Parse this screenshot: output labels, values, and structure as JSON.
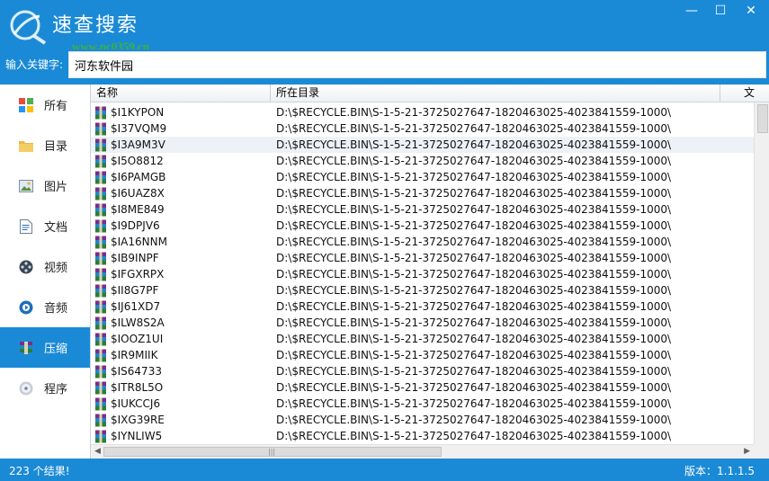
{
  "window": {
    "title": "速查搜索",
    "watermark": "www.pc0359.cn",
    "buttons": {
      "minimize": "—",
      "maximize": "☐",
      "close": "✕"
    }
  },
  "search": {
    "label": "输入关键字:",
    "value": "河东软件园"
  },
  "sidebar": {
    "items": [
      {
        "label": "所有",
        "icon": "all-icon"
      },
      {
        "label": "目录",
        "icon": "folder-icon"
      },
      {
        "label": "图片",
        "icon": "picture-icon"
      },
      {
        "label": "文档",
        "icon": "document-icon"
      },
      {
        "label": "视频",
        "icon": "video-icon"
      },
      {
        "label": "音频",
        "icon": "audio-icon"
      },
      {
        "label": "压缩",
        "icon": "archive-icon",
        "active": true
      },
      {
        "label": "程序",
        "icon": "program-icon"
      }
    ]
  },
  "table": {
    "columns": [
      "名称",
      "所在目录",
      "文"
    ],
    "rows": [
      {
        "name": "$I1KYPON",
        "dir": "D:\\$RECYCLE.BIN\\S-1-5-21-3725027647-1820463025-4023841559-1000\\"
      },
      {
        "name": "$I37VQM9",
        "dir": "D:\\$RECYCLE.BIN\\S-1-5-21-3725027647-1820463025-4023841559-1000\\"
      },
      {
        "name": "$I3A9M3V",
        "dir": "D:\\$RECYCLE.BIN\\S-1-5-21-3725027647-1820463025-4023841559-1000\\",
        "selected": true
      },
      {
        "name": "$I5O8812",
        "dir": "D:\\$RECYCLE.BIN\\S-1-5-21-3725027647-1820463025-4023841559-1000\\"
      },
      {
        "name": "$I6PAMGB",
        "dir": "D:\\$RECYCLE.BIN\\S-1-5-21-3725027647-1820463025-4023841559-1000\\"
      },
      {
        "name": "$I6UAZ8X",
        "dir": "D:\\$RECYCLE.BIN\\S-1-5-21-3725027647-1820463025-4023841559-1000\\"
      },
      {
        "name": "$I8ME849",
        "dir": "D:\\$RECYCLE.BIN\\S-1-5-21-3725027647-1820463025-4023841559-1000\\"
      },
      {
        "name": "$I9DPJV6",
        "dir": "D:\\$RECYCLE.BIN\\S-1-5-21-3725027647-1820463025-4023841559-1000\\"
      },
      {
        "name": "$IA16NNM",
        "dir": "D:\\$RECYCLE.BIN\\S-1-5-21-3725027647-1820463025-4023841559-1000\\"
      },
      {
        "name": "$IB9INPF",
        "dir": "D:\\$RECYCLE.BIN\\S-1-5-21-3725027647-1820463025-4023841559-1000\\"
      },
      {
        "name": "$IFGXRPX",
        "dir": "D:\\$RECYCLE.BIN\\S-1-5-21-3725027647-1820463025-4023841559-1000\\"
      },
      {
        "name": "$II8G7PF",
        "dir": "D:\\$RECYCLE.BIN\\S-1-5-21-3725027647-1820463025-4023841559-1000\\"
      },
      {
        "name": "$IJ61XD7",
        "dir": "D:\\$RECYCLE.BIN\\S-1-5-21-3725027647-1820463025-4023841559-1000\\"
      },
      {
        "name": "$ILW8S2A",
        "dir": "D:\\$RECYCLE.BIN\\S-1-5-21-3725027647-1820463025-4023841559-1000\\"
      },
      {
        "name": "$IOOZ1UI",
        "dir": "D:\\$RECYCLE.BIN\\S-1-5-21-3725027647-1820463025-4023841559-1000\\"
      },
      {
        "name": "$IR9MIIK",
        "dir": "D:\\$RECYCLE.BIN\\S-1-5-21-3725027647-1820463025-4023841559-1000\\"
      },
      {
        "name": "$IS64733",
        "dir": "D:\\$RECYCLE.BIN\\S-1-5-21-3725027647-1820463025-4023841559-1000\\"
      },
      {
        "name": "$ITR8L5O",
        "dir": "D:\\$RECYCLE.BIN\\S-1-5-21-3725027647-1820463025-4023841559-1000\\"
      },
      {
        "name": "$IUKCCJ6",
        "dir": "D:\\$RECYCLE.BIN\\S-1-5-21-3725027647-1820463025-4023841559-1000\\"
      },
      {
        "name": "$IXG39RE",
        "dir": "D:\\$RECYCLE.BIN\\S-1-5-21-3725027647-1820463025-4023841559-1000\\"
      },
      {
        "name": "$IYNLIW5",
        "dir": "D:\\$RECYCLE.BIN\\S-1-5-21-3725027647-1820463025-4023841559-1000\\"
      }
    ]
  },
  "status": {
    "results": "223 个结果!",
    "version": "版本：1.1.1.5"
  },
  "colors": {
    "accent": "#1b8ad6",
    "selected_row": "#eef1f5"
  }
}
